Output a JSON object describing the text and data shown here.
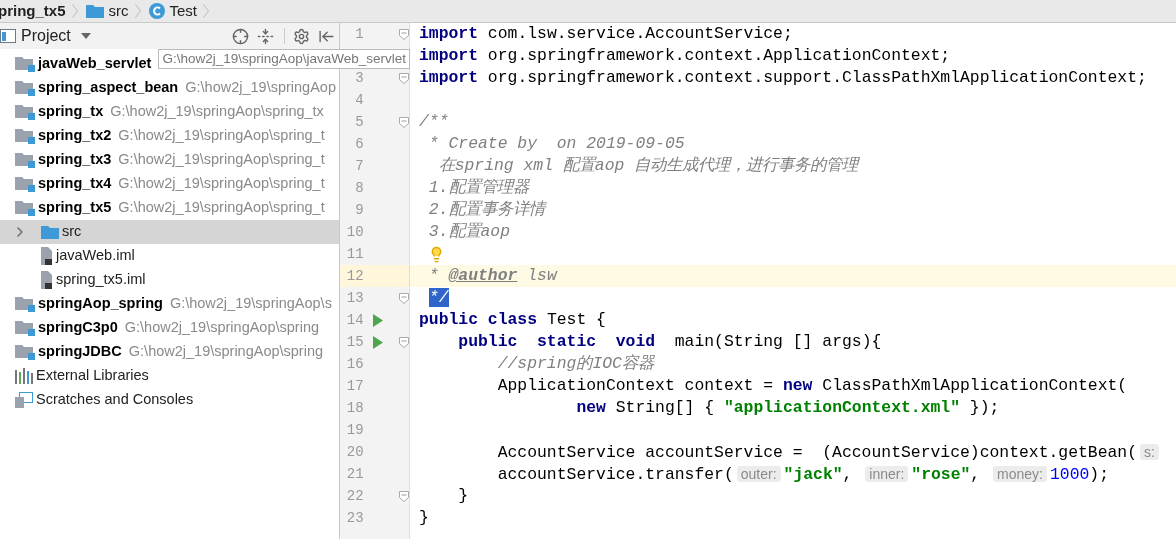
{
  "breadcrumb": [
    {
      "kind": "module",
      "label": "pring_tx5"
    },
    {
      "kind": "folder",
      "label": "src"
    },
    {
      "kind": "class",
      "label": "Test"
    }
  ],
  "project_panel": {
    "title": "Project"
  },
  "tree": [
    {
      "kind": "module",
      "name": "javaWeb_servlet",
      "path": "G:\\how2j_19\\springAop\\javaWeb_servlet",
      "hovered": true
    },
    {
      "kind": "module",
      "name": "spring_aspect_bean",
      "path": "G:\\how2j_19\\springAop",
      "hovered": false
    },
    {
      "kind": "module",
      "name": "spring_tx",
      "path": "G:\\how2j_19\\springAop\\spring_tx",
      "hovered": false
    },
    {
      "kind": "module",
      "name": "spring_tx2",
      "path": "G:\\how2j_19\\springAop\\spring_t",
      "hovered": false
    },
    {
      "kind": "module",
      "name": "spring_tx3",
      "path": "G:\\how2j_19\\springAop\\spring_t",
      "hovered": false
    },
    {
      "kind": "module",
      "name": "spring_tx4",
      "path": "G:\\how2j_19\\springAop\\spring_t",
      "hovered": false
    },
    {
      "kind": "module",
      "name": "spring_tx5",
      "path": "G:\\how2j_19\\springAop\\spring_t",
      "hovered": false,
      "children": [
        {
          "kind": "folder",
          "name": "src",
          "expanded": false,
          "selected": true
        },
        {
          "kind": "file",
          "name": "javaWeb.iml",
          "selected": false
        },
        {
          "kind": "file",
          "name": "spring_tx5.iml",
          "selected": false
        }
      ]
    },
    {
      "kind": "module",
      "name": "springAop_spring",
      "path": "G:\\how2j_19\\springAop\\s",
      "hovered": false
    },
    {
      "kind": "module",
      "name": "springC3p0",
      "path": "G:\\how2j_19\\springAop\\spring",
      "hovered": false
    },
    {
      "kind": "module",
      "name": "springJDBC",
      "path": "G:\\how2j_19\\springAop\\spring",
      "hovered": false
    },
    {
      "kind": "libraries",
      "name": "External Libraries"
    },
    {
      "kind": "scratches",
      "name": "Scratches and Consoles"
    }
  ],
  "editor": {
    "lines": [
      {
        "number": "1",
        "current": false,
        "run": false,
        "fold": true,
        "bulb": false,
        "tokens": [
          {
            "kind": "kw",
            "text": "import"
          },
          {
            "kind": "plain",
            "text": " com.lsw.service.AccountService;"
          }
        ]
      },
      {
        "current": false,
        "bulb": false,
        "tokens": [
          {
            "kind": "kw",
            "text": "import"
          },
          {
            "kind": "plain",
            "text": " org.springframework.context.ApplicationContext;"
          }
        ]
      },
      {
        "number": "3",
        "current": false,
        "run": false,
        "fold": true,
        "bulb": false,
        "tokens": [
          {
            "kind": "kw",
            "text": "import"
          },
          {
            "kind": "plain",
            "text": " org.springframework.context.support.ClassPathXmlApplicationContext;"
          }
        ]
      },
      {
        "number": "4",
        "current": false,
        "run": false,
        "fold": false,
        "bulb": false
      },
      {
        "number": "5",
        "current": false,
        "run": false,
        "fold": true,
        "bulb": false,
        "tokens": [
          {
            "kind": "doc",
            "text": "/**"
          }
        ]
      },
      {
        "number": "6",
        "current": false,
        "run": false,
        "fold": false,
        "bulb": false,
        "tokens": [
          {
            "kind": "doc",
            "text": " * Create by  on 2019-09-05"
          }
        ]
      },
      {
        "number": "7",
        "current": false,
        "run": false,
        "fold": false,
        "bulb": false,
        "tokens": [
          {
            "kind": "doc",
            "text": "  在spring xml 配置aop 自动生成代理，进行事务的管理"
          }
        ]
      },
      {
        "number": "8",
        "current": false,
        "run": false,
        "fold": false,
        "bulb": false,
        "tokens": [
          {
            "kind": "doc",
            "text": " 1.配置管理器"
          }
        ]
      },
      {
        "number": "9",
        "current": false,
        "run": false,
        "fold": false,
        "bulb": false,
        "tokens": [
          {
            "kind": "doc",
            "text": " 2.配置事务详情"
          }
        ]
      },
      {
        "number": "10",
        "current": false,
        "run": false,
        "fold": false,
        "bulb": false,
        "tokens": [
          {
            "kind": "doc",
            "text": " 3.配置aop"
          }
        ]
      },
      {
        "number": "11",
        "current": false,
        "run": false,
        "fold": false,
        "bulb": true
      },
      {
        "number": "12",
        "current": true,
        "run": false,
        "fold": false,
        "bulb": false,
        "tokens": [
          {
            "kind": "doc",
            "text": " * "
          },
          {
            "kind": "doctag",
            "text": "@author"
          },
          {
            "kind": "doc",
            "text": " lsw"
          }
        ]
      },
      {
        "number": "13",
        "current": false,
        "run": false,
        "fold": true,
        "bulb": false,
        "tokens": [
          {
            "kind": "selected",
            "text": " */"
          }
        ]
      },
      {
        "number": "14",
        "current": false,
        "run": true,
        "fold": false,
        "bulb": false,
        "tokens": [
          {
            "kind": "kw",
            "text": "public class"
          },
          {
            "kind": "plain",
            "text": " Test {"
          }
        ]
      },
      {
        "number": "15",
        "current": false,
        "run": true,
        "fold": true,
        "bulb": false,
        "tokens": [
          {
            "kind": "kw",
            "text": "    public  static  void"
          },
          {
            "kind": "plain",
            "text": "  main(String [] args){"
          }
        ]
      },
      {
        "number": "16",
        "current": false,
        "run": false,
        "fold": false,
        "bulb": false,
        "tokens": [
          {
            "kind": "comment",
            "text": "        //spring的IOC容器"
          }
        ]
      },
      {
        "number": "17",
        "current": false,
        "run": false,
        "fold": false,
        "bulb": false,
        "tokens": [
          {
            "kind": "plain",
            "text": "        ApplicationContext context = "
          },
          {
            "kind": "kw",
            "text": "new"
          },
          {
            "kind": "plain",
            "text": " ClassPathXmlApplicationContext("
          }
        ]
      },
      {
        "number": "18",
        "current": false,
        "run": false,
        "fold": false,
        "bulb": false,
        "tokens": [
          {
            "kind": "kw",
            "text": "                new"
          },
          {
            "kind": "plain",
            "text": " String[] { "
          },
          {
            "kind": "string",
            "text": "\"applicationContext.xml\""
          },
          {
            "kind": "plain",
            "text": " });"
          }
        ]
      },
      {
        "number": "19",
        "current": false,
        "run": false,
        "fold": false,
        "bulb": false
      },
      {
        "number": "20",
        "current": false,
        "run": false,
        "fold": false,
        "bulb": false,
        "tokens": [
          {
            "kind": "plain",
            "text": "        AccountService accountService =  (AccountService)context.getBean("
          },
          {
            "kind": "hint",
            "text": "s:"
          }
        ]
      },
      {
        "number": "21",
        "current": false,
        "run": false,
        "fold": false,
        "bulb": false,
        "tokens": [
          {
            "kind": "plain",
            "text": "        accountService.transfer("
          },
          {
            "kind": "hint",
            "text": "outer:"
          },
          {
            "kind": "string",
            "text": "\"jack\""
          },
          {
            "kind": "plain",
            "text": ", "
          },
          {
            "kind": "hint",
            "text": "inner:"
          },
          {
            "kind": "string",
            "text": "\"rose\""
          },
          {
            "kind": "plain",
            "text": ", "
          },
          {
            "kind": "hint",
            "text": "money:"
          },
          {
            "kind": "number",
            "text": "1000"
          },
          {
            "kind": "plain",
            "text": ");"
          }
        ]
      },
      {
        "number": "22",
        "current": false,
        "run": false,
        "fold": true,
        "bulb": false,
        "tokens": [
          {
            "kind": "plain",
            "text": "    }"
          }
        ]
      },
      {
        "number": "23",
        "current": false,
        "run": false,
        "fold": false,
        "bulb": false,
        "tokens": [
          {
            "kind": "plain",
            "text": "}"
          }
        ]
      }
    ]
  }
}
